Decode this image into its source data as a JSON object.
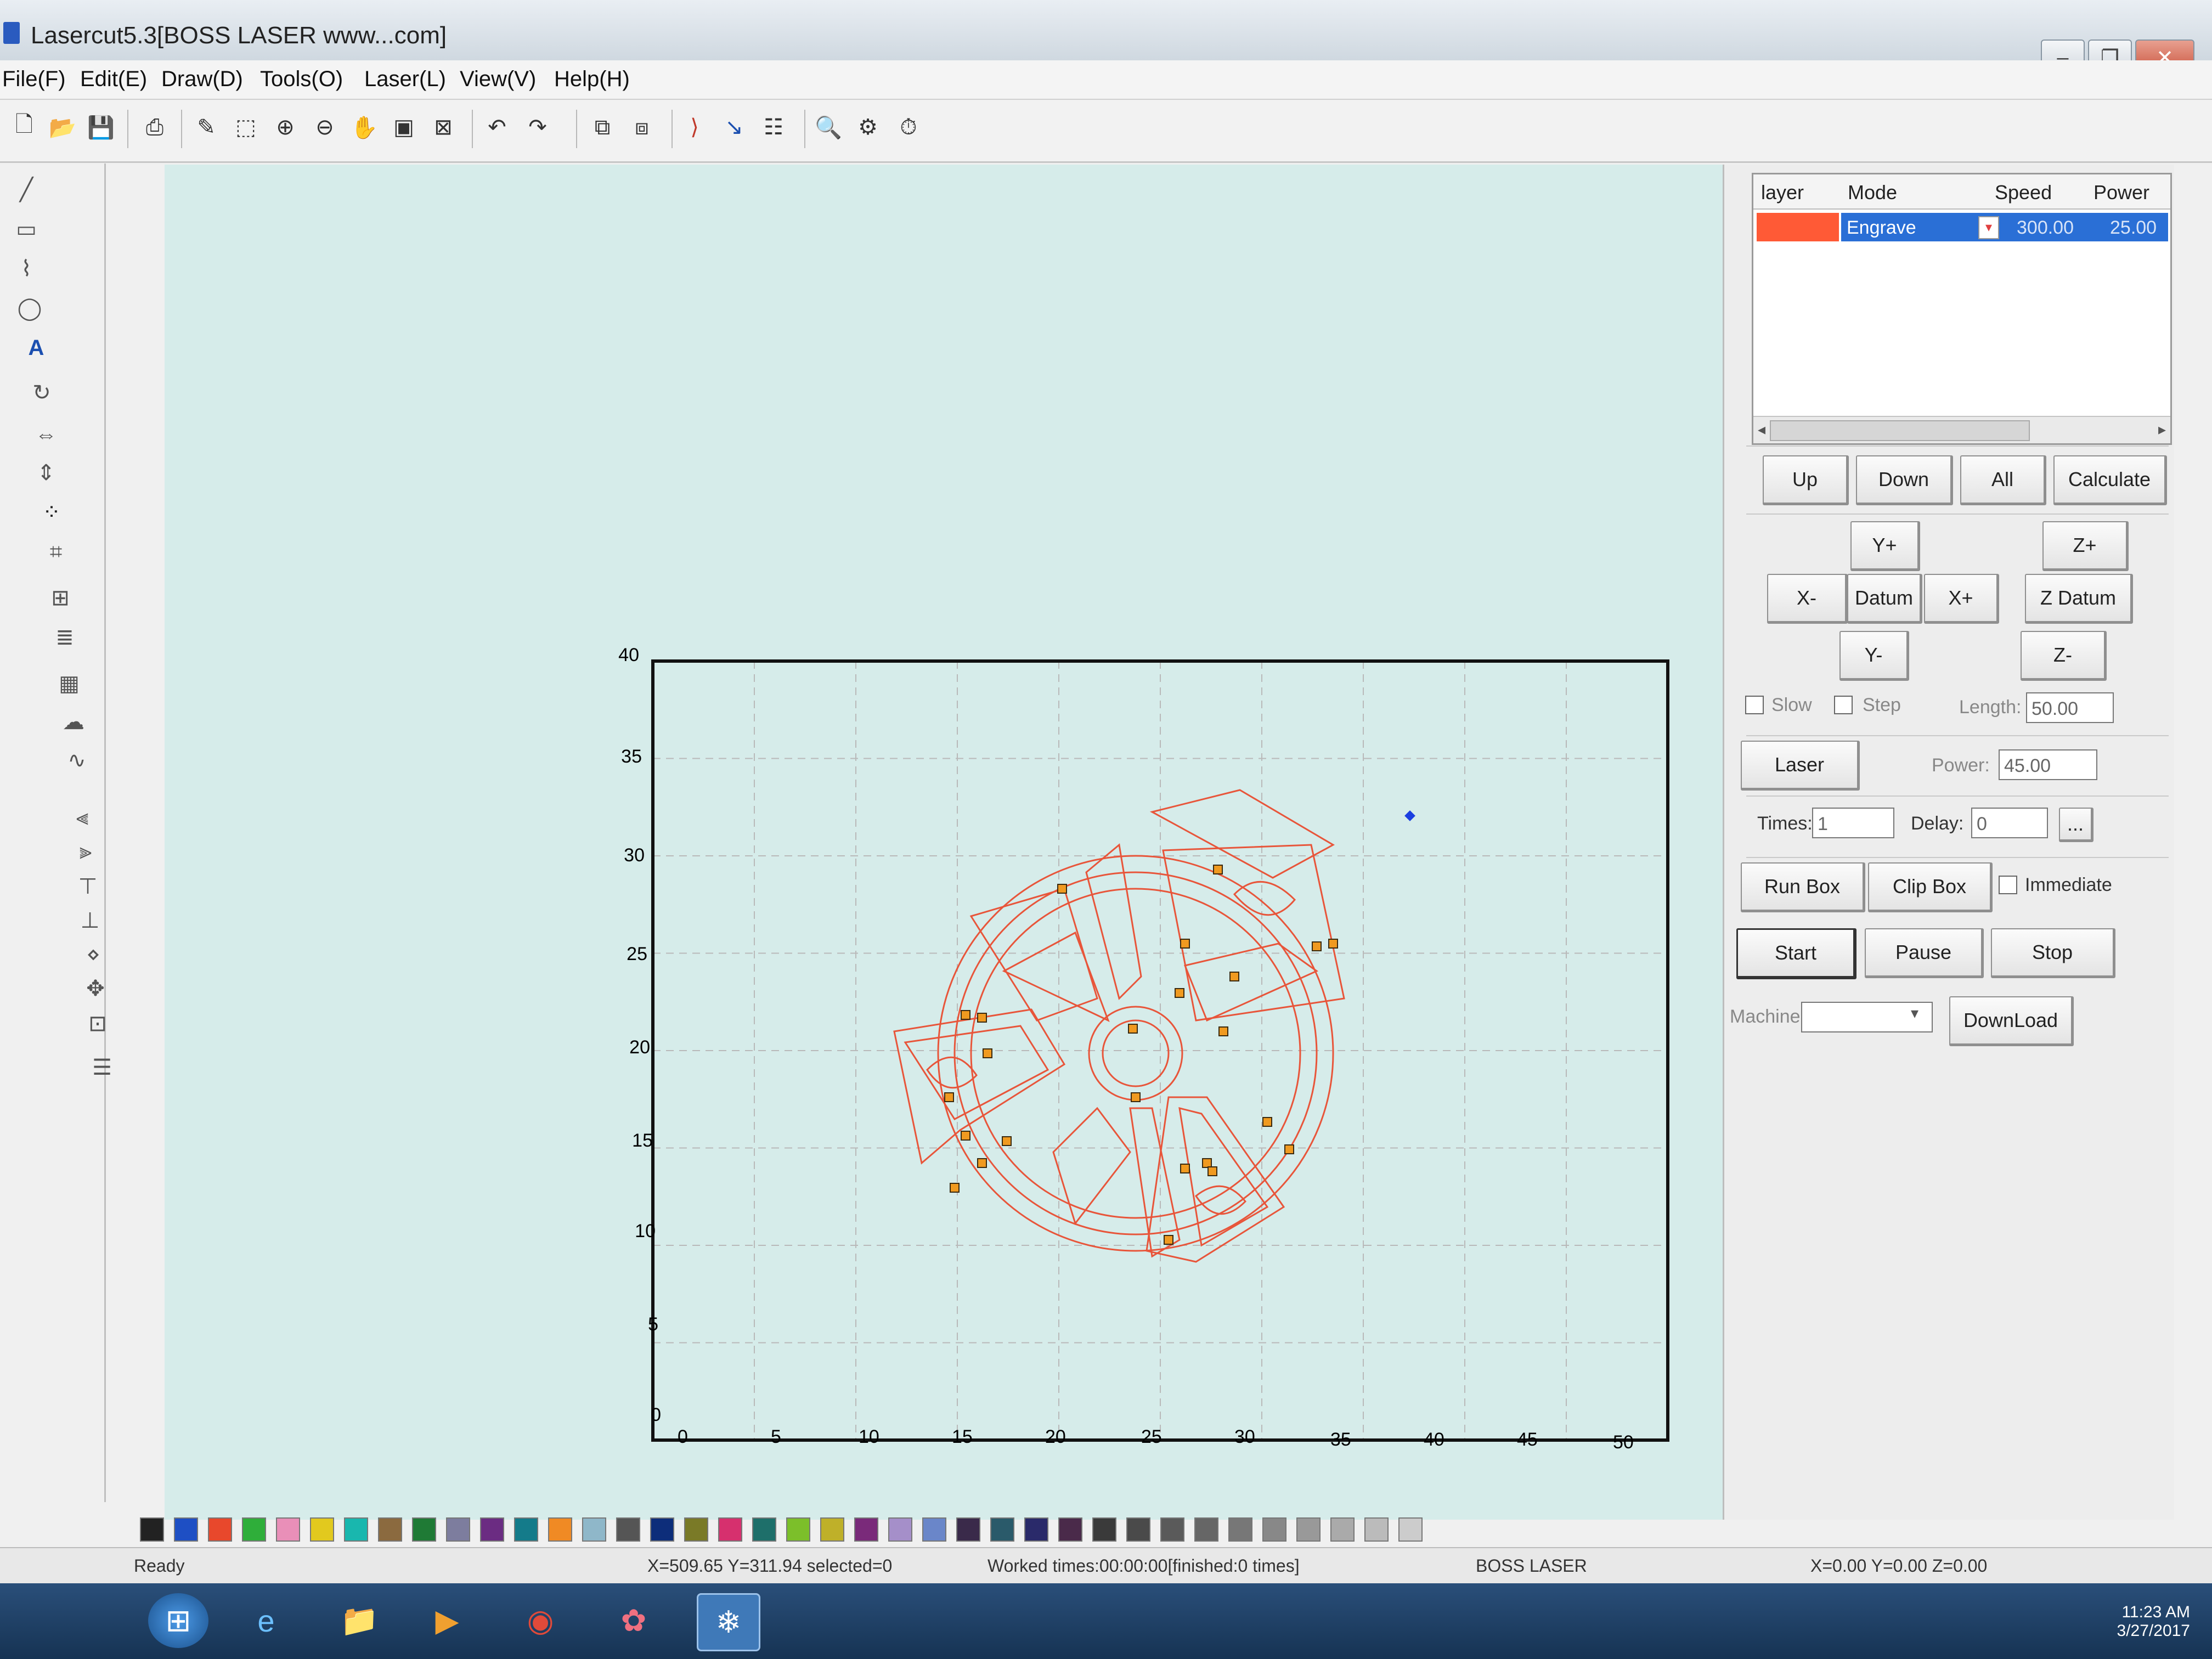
{
  "window": {
    "title": "Lasercut5.3[BOSS LASER www...com]"
  },
  "menu": [
    "File(F)",
    "Edit(E)",
    "Draw(D)",
    "Tools(O)",
    "Laser(L)",
    "View(V)",
    "Help(H)"
  ],
  "layers": {
    "columns": [
      "layer",
      "Mode",
      "Speed",
      "Power"
    ],
    "rows": [
      {
        "color": "#ff5a36",
        "mode": "Engrave",
        "speed": "300.00",
        "power": "25.00"
      }
    ]
  },
  "buttons": {
    "up": "Up",
    "down": "Down",
    "all": "All",
    "calculate": "Calculate",
    "y_plus": "Y+",
    "y_minus": "Y-",
    "x_minus": "X-",
    "x_plus": "X+",
    "datum": "Datum",
    "z_plus": "Z+",
    "z_datum": "Z Datum",
    "z_minus": "Z-",
    "laser": "Laser",
    "run_box": "Run Box",
    "clip_box": "Clip Box",
    "start": "Start",
    "pause": "Pause",
    "stop": "Stop",
    "download": "DownLoad"
  },
  "options": {
    "slow": "Slow",
    "step": "Step",
    "length_label": "Length:",
    "length_value": "50.00",
    "power_label": "Power:",
    "power_value": "45.00",
    "times_label": "Times:",
    "times_value": "1",
    "delay_label": "Delay:",
    "delay_value": "0",
    "delay_more": "...",
    "immediate": "Immediate",
    "machine_label": "Machine:"
  },
  "grid": {
    "x_ticks": [
      "0",
      "5",
      "10",
      "15",
      "20",
      "25",
      "30",
      "35",
      "40",
      "45",
      "50"
    ],
    "y_ticks": [
      "0",
      "5",
      "10",
      "15",
      "20",
      "25",
      "30",
      "35",
      "40"
    ]
  },
  "palette": [
    "#222222",
    "#1e4fc4",
    "#e8482c",
    "#2fae3a",
    "#e98fb8",
    "#e2c91e",
    "#19b7ae",
    "#8b6a3f",
    "#1f7a35",
    "#7d7d9e",
    "#6b2c82",
    "#147b8a",
    "#f08a24",
    "#8fb7c9",
    "#555555",
    "#0d2d7a",
    "#7a7a27",
    "#d6306e",
    "#1e6f6a",
    "#7cbf2a",
    "#bfb029",
    "#7a2a7a",
    "#a58fc9",
    "#6a86c9",
    "#3a2a4a",
    "#2a5a6a",
    "#2a2a6a",
    "#4a2a4a",
    "#3a3a3a",
    "#4a4a4a",
    "#5a5a5a",
    "#666666",
    "#777777",
    "#888888",
    "#999999",
    "#aaaaaa",
    "#bbbbbb",
    "#cccccc"
  ],
  "status": {
    "ready": "Ready",
    "cursor": "X=509.65 Y=311.94 selected=0",
    "worked": "Worked times:00:00:00[finished:0 times]",
    "machine": "BOSS LASER",
    "position": "X=0.00 Y=0.00 Z=0.00"
  },
  "taskbar": {
    "time": "11:23 AM",
    "date": "3/27/2017"
  },
  "colors": {
    "accent": "#2a6fd6",
    "shape": "#e8553a",
    "handle": "#f09a20"
  }
}
